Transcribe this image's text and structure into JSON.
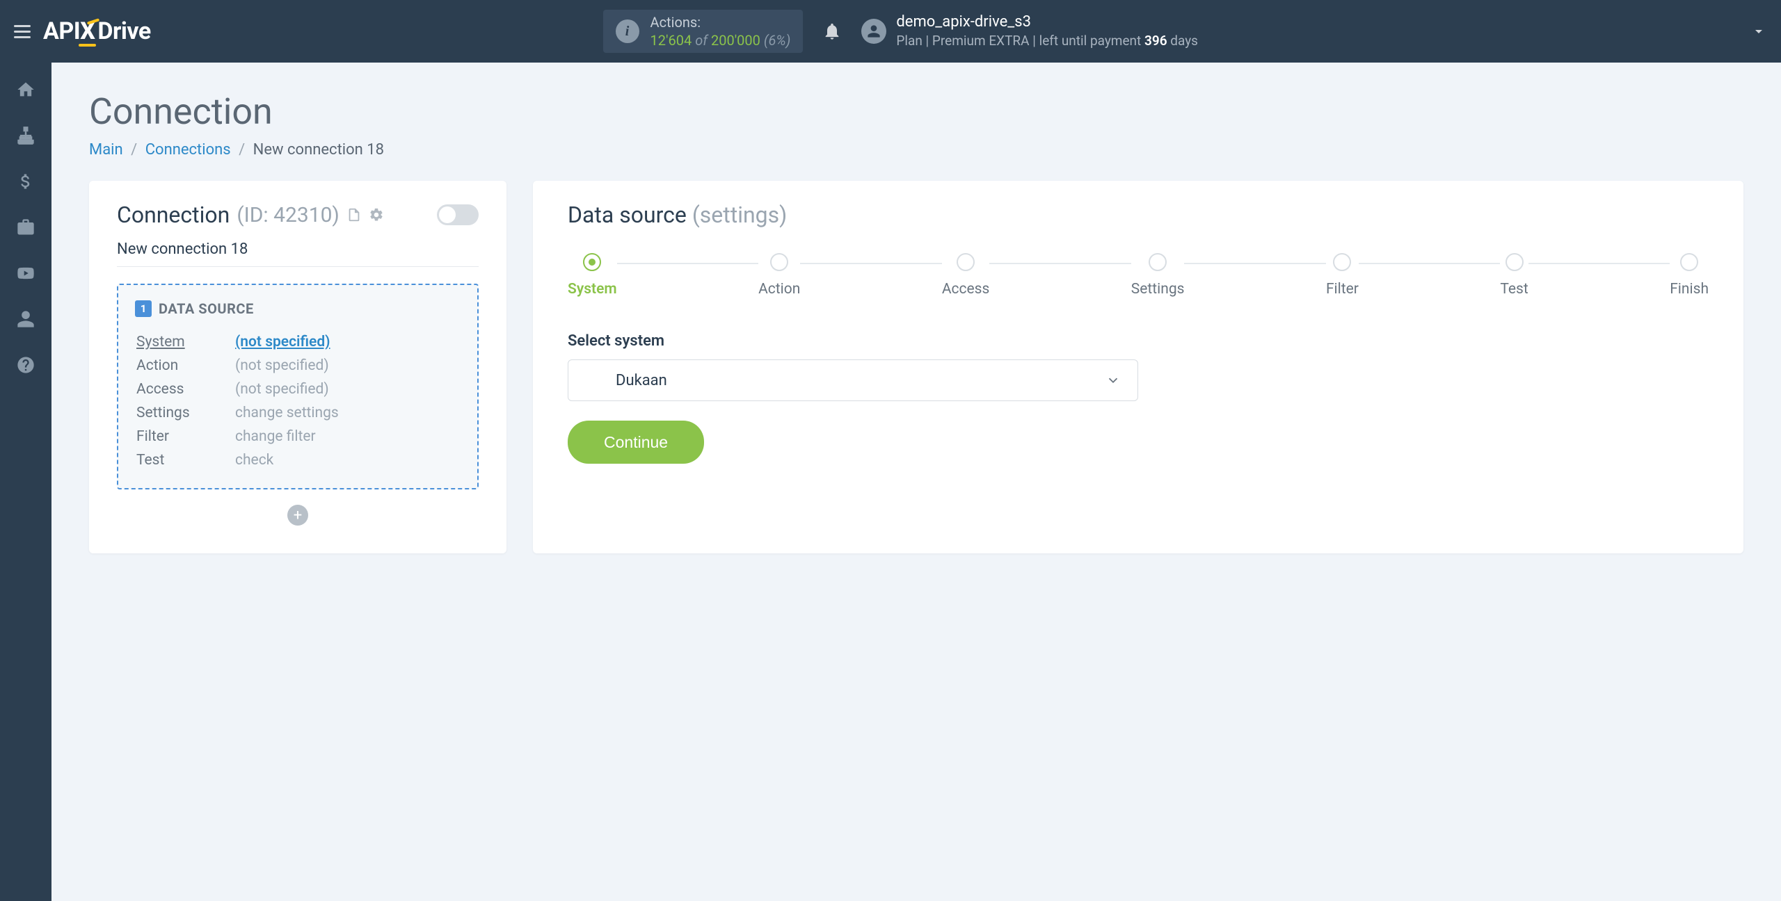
{
  "header": {
    "logo": {
      "part1": "API",
      "part2": "X",
      "part3": "Drive"
    },
    "actions": {
      "label": "Actions:",
      "current": "12'604",
      "of": "of",
      "total": "200'000",
      "percent": "(6%)"
    },
    "user": {
      "name": "demo_apix-drive_s3",
      "plan_prefix": "Plan |",
      "plan_name": "Premium EXTRA",
      "plan_mid": "| left until payment",
      "days_number": "396",
      "days_suffix": "days"
    }
  },
  "page": {
    "title": "Connection",
    "breadcrumb": {
      "main": "Main",
      "connections": "Connections",
      "current": "New connection 18"
    }
  },
  "conn_panel": {
    "title": "Connection",
    "id_label": "(ID: 42310)",
    "name": "New connection 18",
    "source": {
      "badge": "1",
      "title": "DATA SOURCE",
      "rows": [
        {
          "label": "System",
          "value": "(not specified)",
          "underline": true,
          "link": true
        },
        {
          "label": "Action",
          "value": "(not specified)"
        },
        {
          "label": "Access",
          "value": "(not specified)"
        },
        {
          "label": "Settings",
          "value": "change settings"
        },
        {
          "label": "Filter",
          "value": "change filter"
        },
        {
          "label": "Test",
          "value": "check"
        }
      ]
    }
  },
  "ds_panel": {
    "title": "Data source",
    "subtitle": "(settings)",
    "steps": [
      "System",
      "Action",
      "Access",
      "Settings",
      "Filter",
      "Test",
      "Finish"
    ],
    "active_step": 0,
    "select_label": "Select system",
    "selected_value": "Dukaan",
    "continue": "Continue"
  }
}
